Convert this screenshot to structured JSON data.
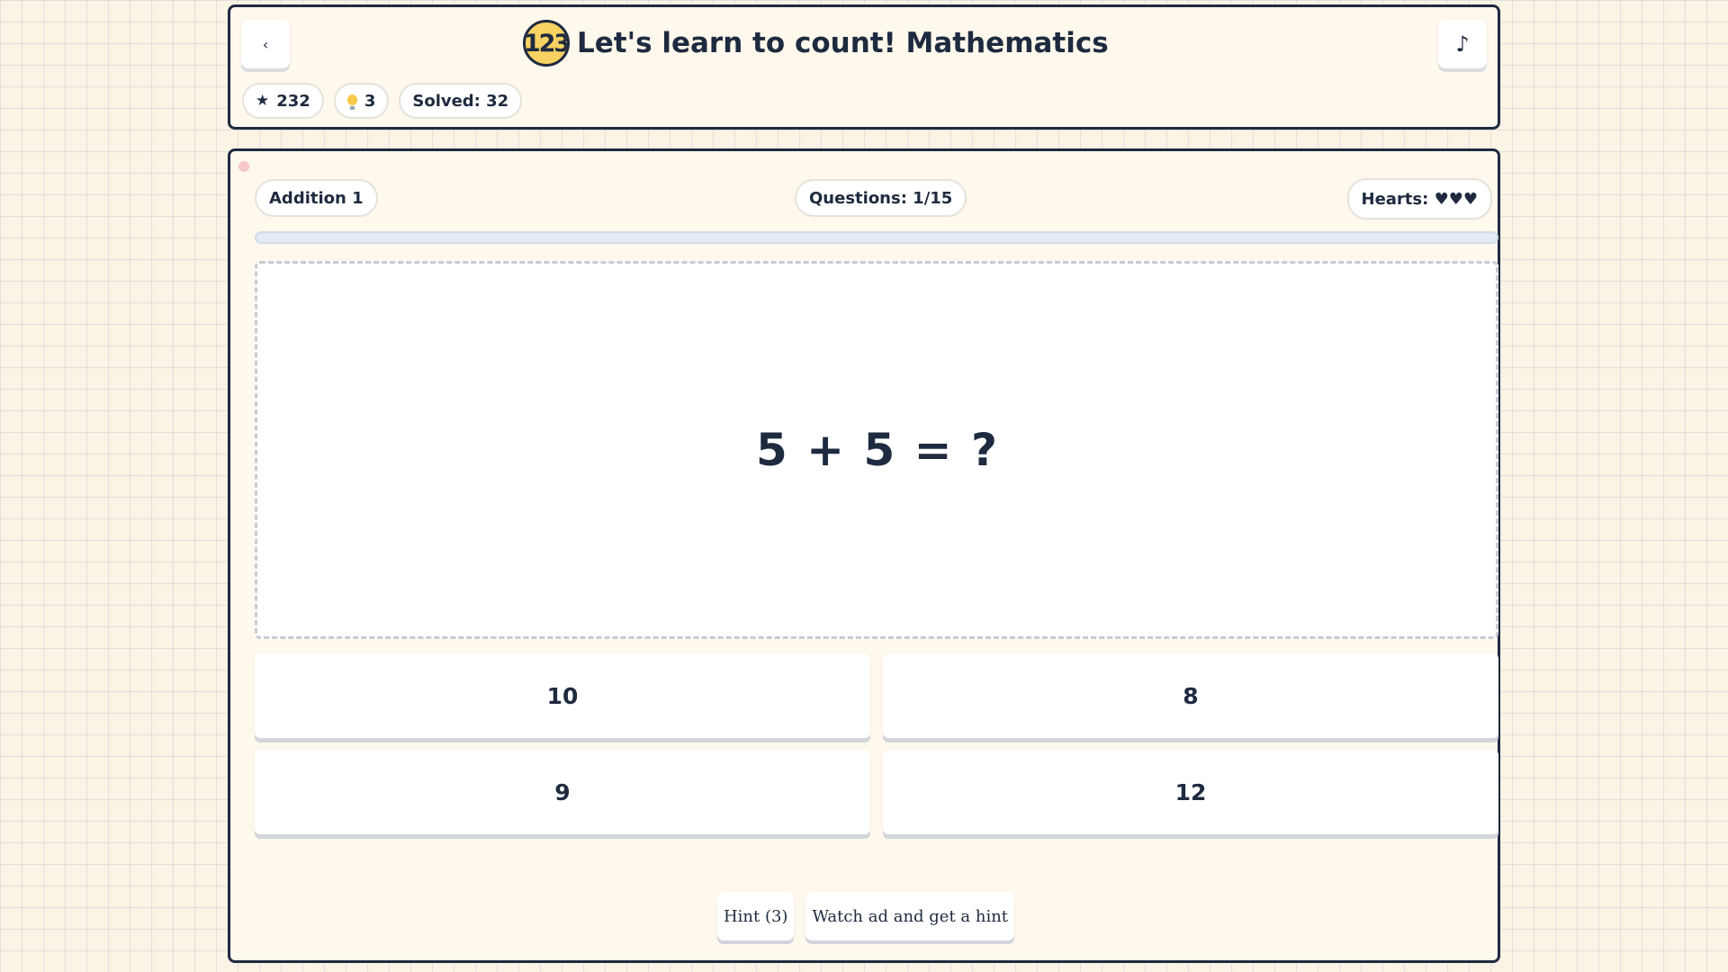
{
  "header": {
    "back_label": "‹",
    "logo_text": "123",
    "title": "Let's learn to count! Mathematics",
    "music_label": "♪",
    "stats": {
      "stars_icon": "★",
      "stars": "232",
      "hints_icon": "lightbulb-icon",
      "hints": "3",
      "solved": "Solved: 32"
    }
  },
  "game": {
    "level": "Addition 1",
    "questions": "Questions: 1/15",
    "hearts": "Hearts: ♥♥♥",
    "progress_fraction": 0,
    "question": "5 + 5 = ?",
    "answers": [
      "10",
      "8",
      "9",
      "12"
    ],
    "hint_button": "Hint (3)",
    "ad_hint_button": "Watch ad and get a hint"
  },
  "colors": {
    "ink": "#1e2a3f",
    "logo_badge": "#f8d262",
    "card_background": "#fff8ec",
    "page_background": "#fbf3e4",
    "progress_track": "#e3ebf4",
    "status_dot": "#f6c7c9"
  }
}
